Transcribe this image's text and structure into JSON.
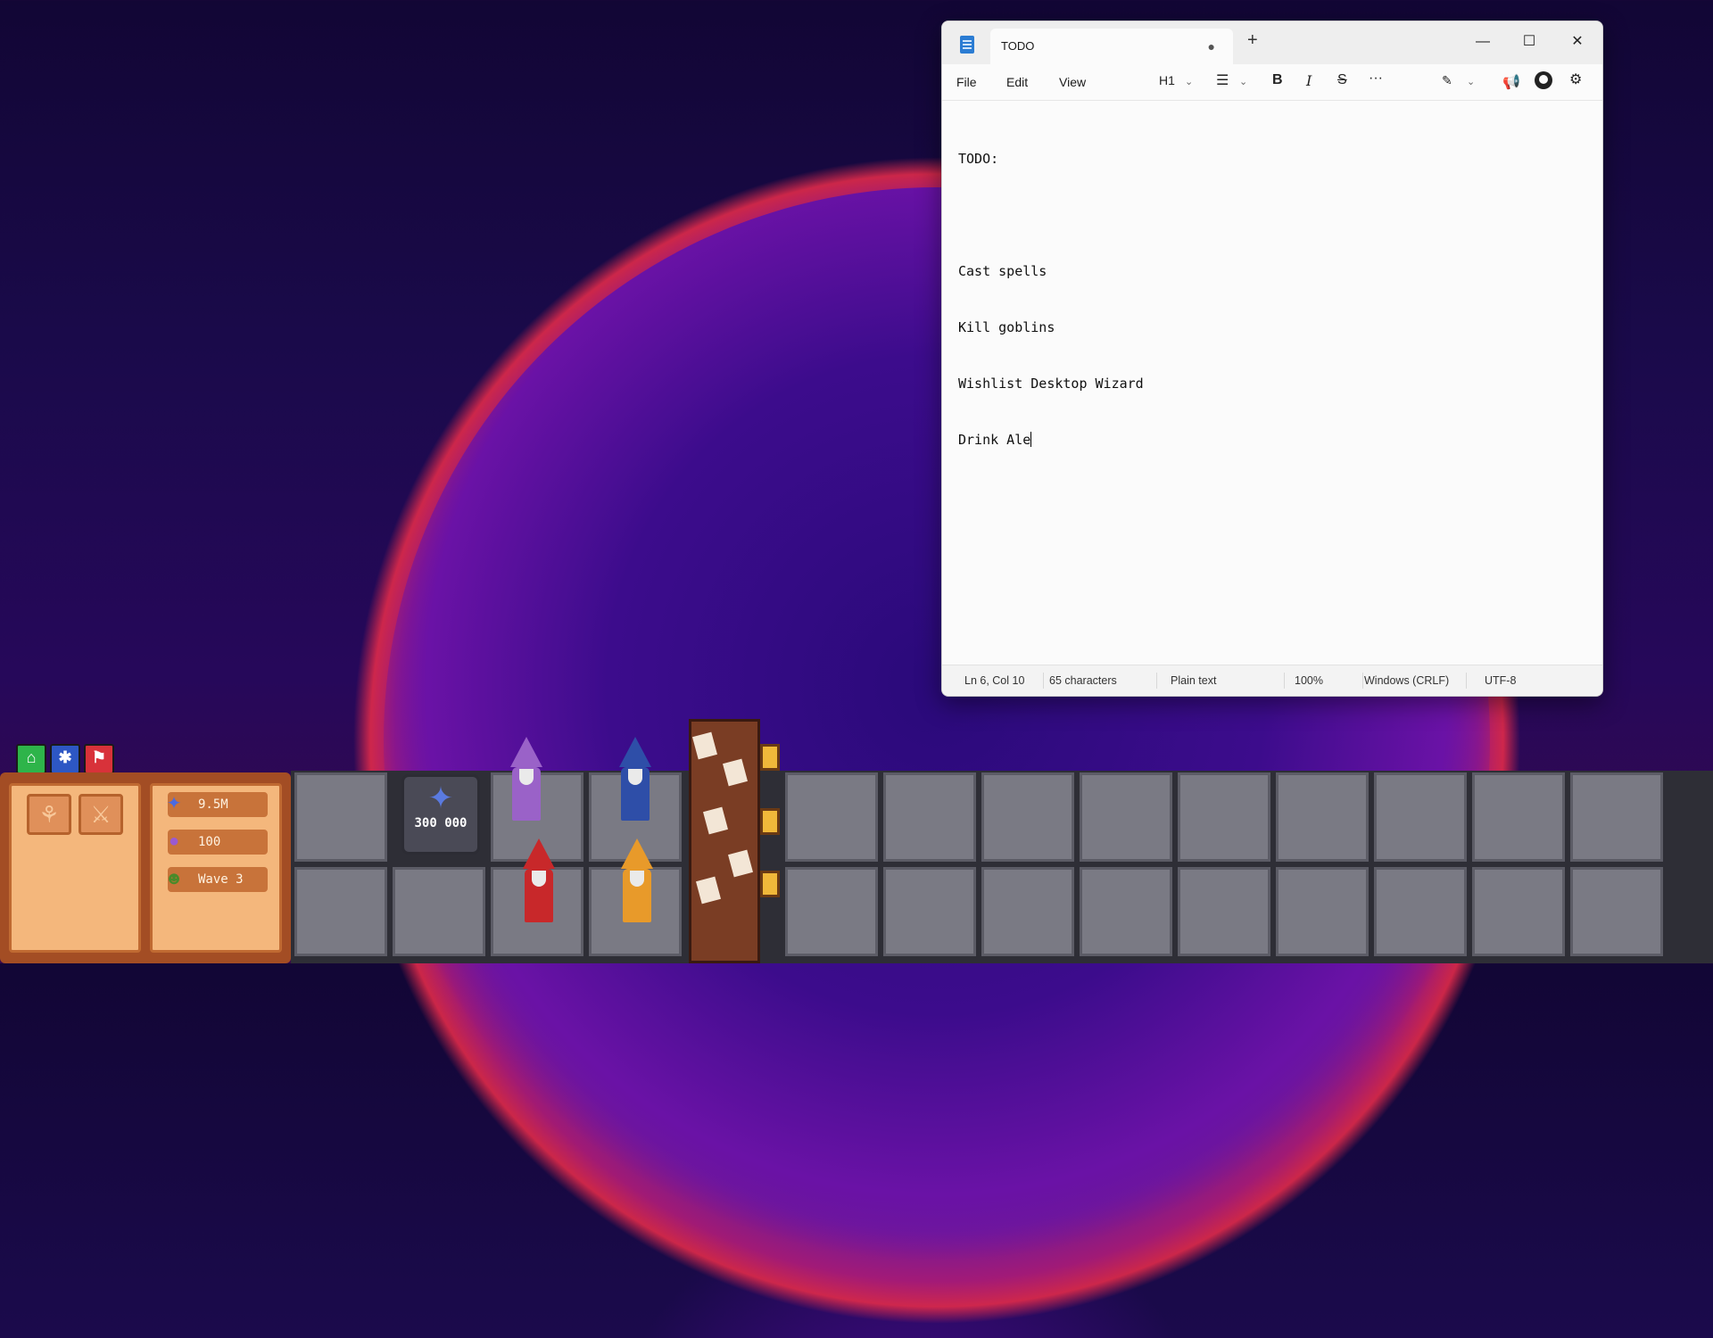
{
  "notepad": {
    "tab_title": "TODO",
    "tab_modified_dot": "●",
    "new_tab": "+",
    "window_controls": {
      "minimize": "—",
      "maximize": "☐",
      "close": "✕"
    },
    "menu": {
      "file": "File",
      "edit": "Edit",
      "view": "View"
    },
    "toolbar": {
      "heading": "H1",
      "chevron": "⌄",
      "list": "☰",
      "bold": "B",
      "italic": "I",
      "strikethrough": "S",
      "more": "···",
      "copilot": "✎",
      "announce": "📢",
      "settings": "⚙"
    },
    "content": {
      "lines": [
        "TODO:",
        "",
        "Cast spells",
        "Kill goblins",
        "Wishlist Desktop Wizard",
        "Drink Ale"
      ]
    },
    "status": {
      "position": "Ln 6, Col 10",
      "characters": "65 characters",
      "format": "Plain text",
      "zoom": "100%",
      "line_ending": "Windows (CRLF)",
      "encoding": "UTF-8"
    }
  },
  "game": {
    "hud_icons": [
      "home-icon",
      "gear-icon",
      "flag-icon"
    ],
    "hud_glyphs": {
      "home": "⌂",
      "settings": "✱",
      "flag": "⚑"
    },
    "book_buttons": {
      "skills": "⚘",
      "attack": "⚔"
    },
    "resources": {
      "mana": {
        "icon": "✦",
        "value": "9.5M"
      },
      "gems": {
        "icon": "●",
        "value": "100"
      },
      "wave": {
        "icon": "☻",
        "value": "Wave 3"
      }
    },
    "mana_shop": {
      "icon": "✦",
      "price": "300 000"
    },
    "colors": {
      "wizard_purple": "#9a62c8",
      "wizard_blue": "#2e4ea8",
      "wizard_red": "#c8282a",
      "wizard_orange": "#e89a2a"
    }
  }
}
